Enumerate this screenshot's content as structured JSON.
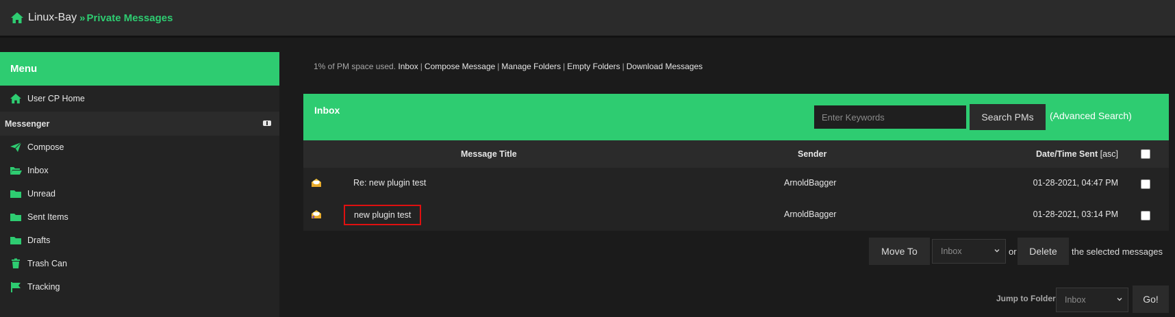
{
  "breadcrumb": {
    "site": "Linux-Bay",
    "separator": "»",
    "current": "Private Messages"
  },
  "sidebar": {
    "menu_title": "Menu",
    "user_cp": "User CP Home",
    "section": "Messenger",
    "items": [
      {
        "label": "Compose",
        "icon": "paper-plane-icon"
      },
      {
        "label": "Inbox",
        "icon": "folder-open-icon"
      },
      {
        "label": "Unread",
        "icon": "folder-icon"
      },
      {
        "label": "Sent Items",
        "icon": "folder-icon"
      },
      {
        "label": "Drafts",
        "icon": "folder-icon"
      },
      {
        "label": "Trash Can",
        "icon": "trash-icon"
      },
      {
        "label": "Tracking",
        "icon": "flag-icon"
      }
    ]
  },
  "quota": {
    "text": "1%  of PM space used.",
    "links": [
      "Inbox",
      "Compose Message",
      "Manage Folders",
      "Empty Folders",
      "Download Messages"
    ]
  },
  "inbox": {
    "title": "Inbox",
    "search_placeholder": "Enter Keywords",
    "search_button": "Search PMs",
    "advanced_search": "(Advanced Search)"
  },
  "table": {
    "headers": {
      "title": "Message Title",
      "sender": "Sender",
      "date": "Date/Time Sent",
      "sort": "[asc]"
    },
    "rows": [
      {
        "title": "Re: new plugin test",
        "sender": "ArnoldBagger",
        "date": "01-28-2021, 04:47 PM"
      },
      {
        "title": "new plugin test",
        "sender": "ArnoldBagger",
        "date": "01-28-2021, 03:14 PM"
      }
    ]
  },
  "actions": {
    "move_to": "Move To",
    "move_target": "Inbox",
    "or": "or",
    "delete": "Delete",
    "suffix": "the selected messages",
    "jump_label": "Jump to Folder:",
    "jump_target": "Inbox",
    "go": "Go!"
  },
  "colors": {
    "accent": "#2ecc71",
    "highlight_box": "#e01010"
  }
}
